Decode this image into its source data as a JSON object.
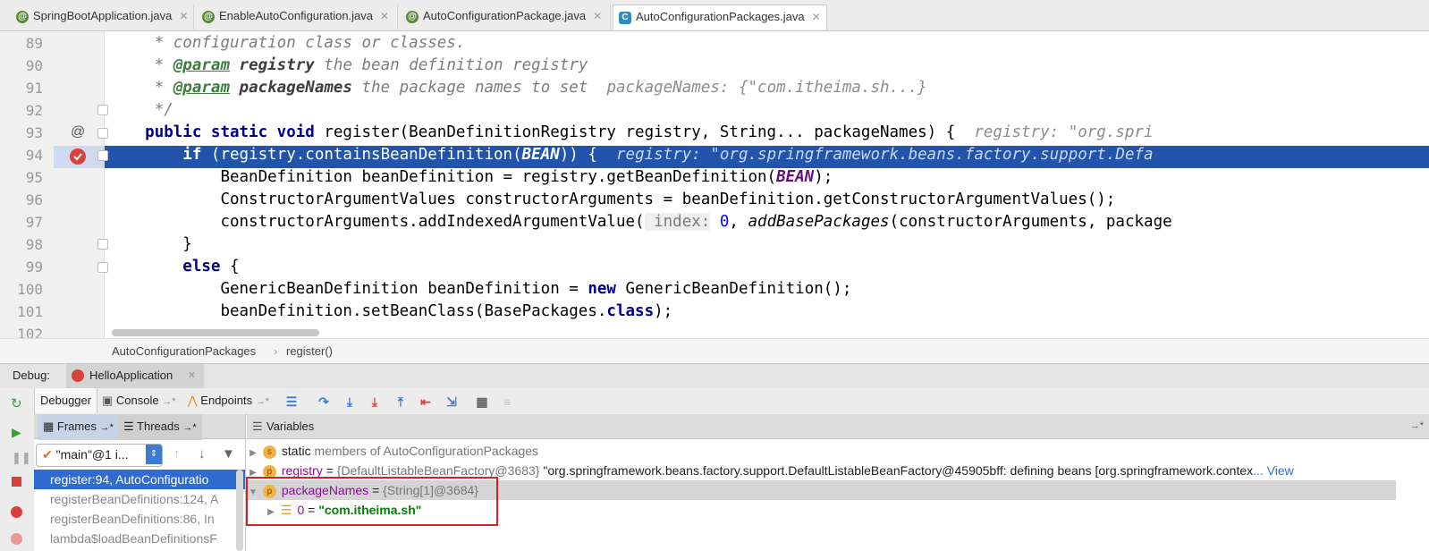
{
  "tabs": [
    {
      "label": "SpringBootApplication.java",
      "icon": "annotation-icon",
      "active": false
    },
    {
      "label": "EnableAutoConfiguration.java",
      "icon": "annotation-icon",
      "active": false
    },
    {
      "label": "AutoConfigurationPackage.java",
      "icon": "annotation-icon",
      "active": false
    },
    {
      "label": "AutoConfigurationPackages.java",
      "icon": "class-icon",
      "active": true
    }
  ],
  "editor": {
    "line_numbers": [
      "89",
      "90",
      "91",
      "92",
      "93",
      "94",
      "95",
      "96",
      "97",
      "98",
      "99",
      "100",
      "101",
      "102"
    ],
    "code": {
      "l89": "* configuration class or classes.",
      "l90_tag": "@param",
      "l90_name": "registry",
      "l90_text": "the bean definition registry",
      "l91_tag": "@param",
      "l91_name": "packageNames",
      "l91_text": "the package names to set",
      "l91_hint": "packageNames: {\"com.itheima.sh...}",
      "l92": "*/",
      "l93_kw": "public static void",
      "l93_rest": "register(BeanDefinitionRegistry registry, String... packageNames) {",
      "l93_hint": "registry: \"org.spri",
      "l94_kw": "if",
      "l94_a": "(registry.containsBeanDefinition(",
      "l94_const": "BEAN",
      "l94_b": ")) {",
      "l94_hint": "registry: \"org.springframework.beans.factory.support.Defa",
      "l95_a": "BeanDefinition beanDefinition = registry.getBeanDefinition(",
      "l95_const": "BEAN",
      "l95_b": ");",
      "l96": "ConstructorArgumentValues constructorArguments = beanDefinition.getConstructorArgumentValues();",
      "l97_a": "constructorArguments.addIndexedArgumentValue(",
      "l97_param": "index:",
      "l97_num": "0",
      "l97_c": ",",
      "l97_method": "addBasePackages",
      "l97_d": "(constructorArguments, package",
      "l98": "}",
      "l99_kw": "else",
      "l99_rest": "{",
      "l100_a": "GenericBeanDefinition beanDefinition =",
      "l100_kw": "new",
      "l100_b": "GenericBeanDefinition();",
      "l101_a": "beanDefinition.setBeanClass(BasePackages.",
      "l101_kw": "class",
      "l101_b": ");"
    }
  },
  "breadcrumb": {
    "class": "AutoConfigurationPackages",
    "sep": "›",
    "method": "register()"
  },
  "debug": {
    "label": "Debug:",
    "session": "HelloApplication",
    "tabs": [
      "Debugger",
      "Console",
      "Endpoints"
    ],
    "tab_suffix": "→*"
  },
  "frames": {
    "tab_frames": "Frames",
    "tab_threads": "Threads",
    "thread_selector": "\"main\"@1 i...",
    "items": [
      "register:94, AutoConfiguratio",
      "registerBeanDefinitions:124, A",
      "registerBeanDefinitions:86, In",
      "lambda$loadBeanDefinitionsF"
    ]
  },
  "variables": {
    "header": "Variables",
    "header_right": "→*",
    "rows": [
      {
        "badge": "s",
        "name": "static",
        "eq": "",
        "type": "members of AutoConfigurationPackages",
        "value": ""
      },
      {
        "badge": "p",
        "name": "registry",
        "eq": "=",
        "type": "{DefaultListableBeanFactory@3683}",
        "value": "\"org.springframework.beans.factory.support.DefaultListableBeanFactory@45905bff: defining beans [org.springframework.contex",
        "trail": "... View"
      },
      {
        "badge": "p",
        "name": "packageNames",
        "eq": "=",
        "type": "{String[1]@3684}",
        "value": ""
      },
      {
        "badge": "",
        "name": "0",
        "eq": "=",
        "type": "",
        "value": "\"com.itheima.sh\""
      }
    ]
  }
}
